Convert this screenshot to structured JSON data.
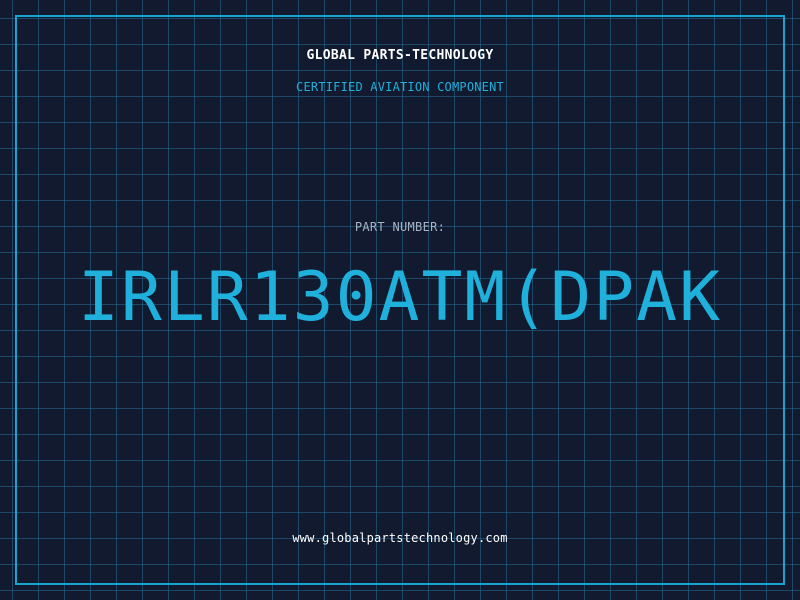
{
  "header": {
    "company": "GLOBAL PARTS-TECHNOLOGY",
    "subtitle": "CERTIFIED AVIATION COMPONENT"
  },
  "part": {
    "label": "PART NUMBER:",
    "number": "IRLR130ATM(DPAK"
  },
  "footer": {
    "website": "www.globalpartstechnology.com"
  },
  "colors": {
    "background": "#111a2e",
    "grid": "#286e96",
    "accent": "#1fb0dc",
    "frame": "#1aa3cc",
    "text_primary": "#ffffff",
    "text_muted": "#a6b3c4"
  }
}
